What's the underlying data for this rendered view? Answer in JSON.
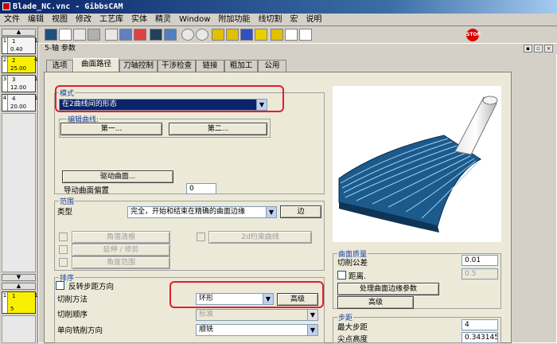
{
  "window": {
    "title": "Blade_NC.vnc - GibbsCAM"
  },
  "menu": [
    "文件",
    "编辑",
    "视图",
    "修改",
    "工艺库",
    "实体",
    "精灵",
    "Window",
    "附加功能",
    "线切割",
    "宏",
    "说明"
  ],
  "stop_label": "STOP",
  "tools": [
    {
      "slot": "1",
      "num": "1",
      "value": "0.40",
      "r": "1"
    },
    {
      "slot": "2",
      "num": "2",
      "value": "25.00",
      "r": "4"
    },
    {
      "slot": "3",
      "num": "3",
      "value": "12.00",
      "r": "1"
    },
    {
      "slot": "4",
      "num": "4",
      "value": "20.00",
      "r": "1"
    },
    {
      "slot": "1",
      "num": "1",
      "value": "5",
      "r": "1"
    }
  ],
  "dialog": {
    "title": "5-轴 参数",
    "tabs": [
      "选项",
      "曲面路径",
      "刀轴控制",
      "干涉检查",
      "链接",
      "粗加工",
      "公用"
    ],
    "mode": {
      "label": "模式",
      "value": "在2曲线间的形态"
    },
    "edit_curve": {
      "label": "编辑曲线:",
      "first": "第一...",
      "second": "第二..."
    },
    "drive_surface_btn": "驱动曲面...",
    "offset": {
      "label": "导动曲面偏置",
      "value": "0"
    },
    "range": {
      "label": "范围",
      "type_label": "类型",
      "type_value": "完全，开始和结束在精确的曲面边缘",
      "edge_btn": "边",
      "corner_btn": "角落清根",
      "extend_btn": "延伸 / 修剪",
      "angle_btn": "角度范围",
      "boundary_btn": "2d约束曲线"
    },
    "order": {
      "label": "排序",
      "reverse_label": "反转步距方向",
      "cut_method_label": "切削方法",
      "cut_method_value": "环形",
      "advanced_btn": "高级",
      "cut_order_label": "切削顺序",
      "cut_order_value": "标准",
      "direction_label": "单向铣削方向",
      "direction_value": "顺铣"
    },
    "quality": {
      "label": "曲面质量",
      "tolerance_label": "切削公差",
      "tolerance_value": "0.01",
      "distance_label": "距离.",
      "distance_value": "0.5",
      "edge_btn": "处理曲面边缘参数",
      "advanced_btn": "高级"
    },
    "step": {
      "label": "步距",
      "max_label": "最大步距",
      "max_value": "4",
      "cusp_label": "尖点高度",
      "cusp_value": "0.3431453"
    }
  }
}
